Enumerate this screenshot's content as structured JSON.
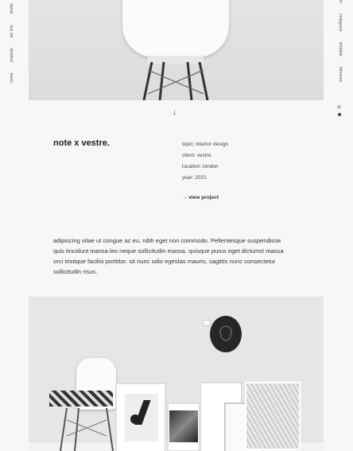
{
  "left_nav": [
    "home.",
    "projects.",
    "we hire.",
    "studio."
  ],
  "right_nav": [
    "in.",
    "instagram.",
    "dribbble.",
    "behance."
  ],
  "scroll_arrow": "↓",
  "project": {
    "title": "note x vestre.",
    "topic": "topic: interior design",
    "client": "client: vestre",
    "location": "location: london",
    "year": "year: 2021",
    "view_link": "→ view project"
  },
  "description": "adipiscing vitae ut congue ac eu. nibh eget non commodo. Pellentesque suspendisse quis tincidunt massa leo neque sollicitudin massa. quisque purus eget dictumst massa orci tristique facilisi porttitor. sit nunc odio egestas mauris, sagittis nunc consectetur sollicitudin risus."
}
